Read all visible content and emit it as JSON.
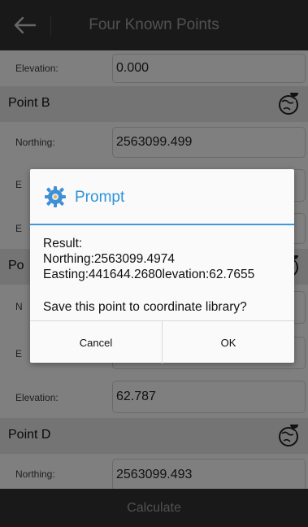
{
  "app_bar": {
    "title": "Four Known Points"
  },
  "rows": {
    "elevation_top": {
      "label": "Elevation:",
      "value": "0.000"
    },
    "point_b": {
      "title": "Point B",
      "northing": {
        "label": "Northing:",
        "value": "2563099.499"
      },
      "easting_label_fragment": "E",
      "elevation_label_fragment": "E"
    },
    "point_c": {
      "title_fragment": "Po",
      "northing_label_fragment": "N",
      "easting_label_fragment": "E",
      "elevation": {
        "label": "Elevation:",
        "value": "62.787"
      }
    },
    "point_d": {
      "title": "Point D",
      "northing": {
        "label": "Northing:",
        "value": "2563099.493"
      }
    }
  },
  "bottom_bar": {
    "label": "Calculate"
  },
  "dialog": {
    "title": "Prompt",
    "lines": [
      "Result:",
      "Northing:2563099.4974",
      "Easting:441644.2680levation:62.7655"
    ],
    "question": "Save this point to coordinate library?",
    "cancel_label": "Cancel",
    "ok_label": "OK"
  },
  "colors": {
    "bar": "#333333",
    "accent": "#3d9ad9",
    "section": "#e8e8e8"
  },
  "icons": {
    "back": "arrow-left-icon",
    "map": "map-pin-globe-icon",
    "dialog": "gear-icon"
  }
}
